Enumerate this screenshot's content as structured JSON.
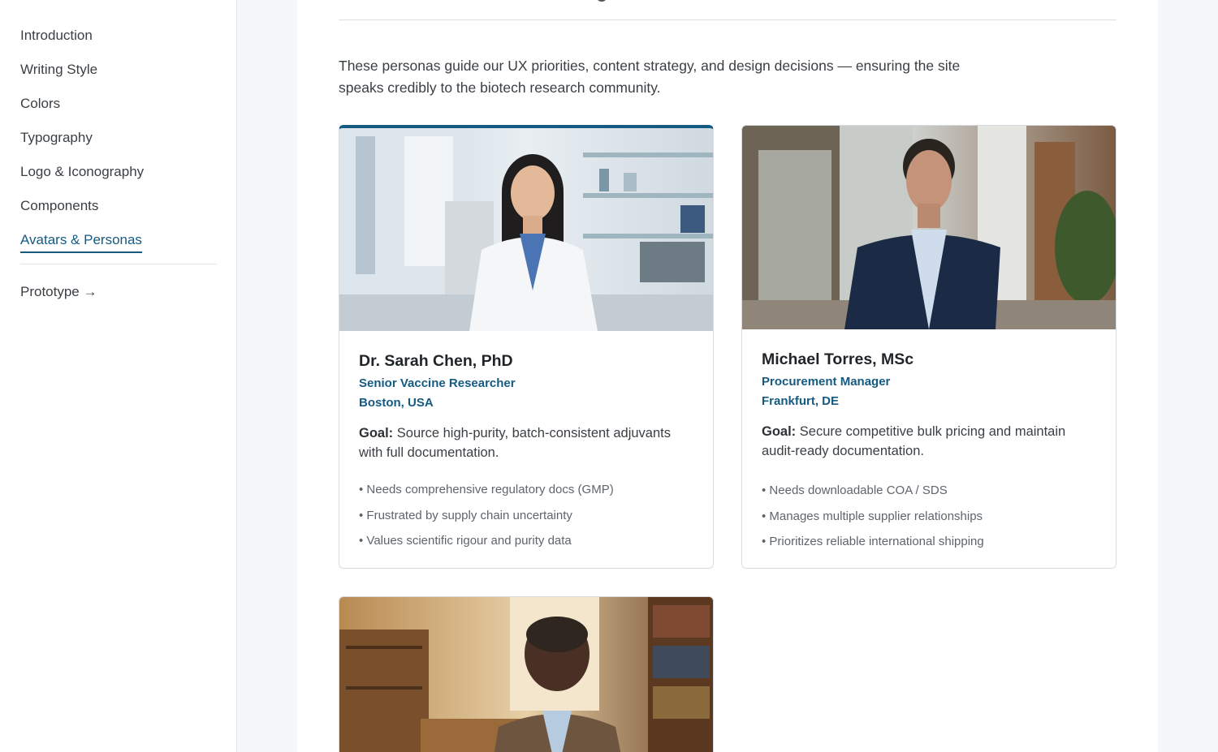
{
  "sidebar": {
    "items": [
      {
        "label": "Introduction"
      },
      {
        "label": "Writing Style"
      },
      {
        "label": "Colors"
      },
      {
        "label": "Typography"
      },
      {
        "label": "Logo & Iconography"
      },
      {
        "label": "Components"
      },
      {
        "label": "Avatars & Personas"
      }
    ],
    "active_index": 6,
    "prototype_label": "Prototype →"
  },
  "main": {
    "intro": "These personas guide our UX priorities, content strategy, and design decisions — ensuring the site speaks credibly to the biotech research community.",
    "personas": [
      {
        "name": "Dr. Sarah Chen, PhD",
        "role": "Senior Vaccine Researcher",
        "location": "Boston, USA",
        "goal_label": "Goal:",
        "goal": "Source high-purity, batch-consistent adjuvants with full documentation.",
        "points": [
          "Needs comprehensive regulatory docs (GMP)",
          "Frustrated by supply chain uncertainty",
          "Values scientific rigour and purity data"
        ],
        "photo_icon": "persona-photo-lab"
      },
      {
        "name": "Michael Torres, MSc",
        "role": "Procurement Manager",
        "location": "Frankfurt, DE",
        "goal_label": "Goal:",
        "goal": "Secure competitive bulk pricing and maintain audit-ready documentation.",
        "points": [
          "Needs downloadable COA / SDS",
          "Manages multiple supplier relationships",
          "Prioritizes reliable international shipping"
        ],
        "photo_icon": "persona-photo-office"
      },
      {
        "photo_icon": "persona-photo-library"
      }
    ]
  },
  "colors": {
    "accent": "#145a82",
    "text": "#3a3f44",
    "muted": "#5e656c",
    "border": "#d7dbe0"
  }
}
